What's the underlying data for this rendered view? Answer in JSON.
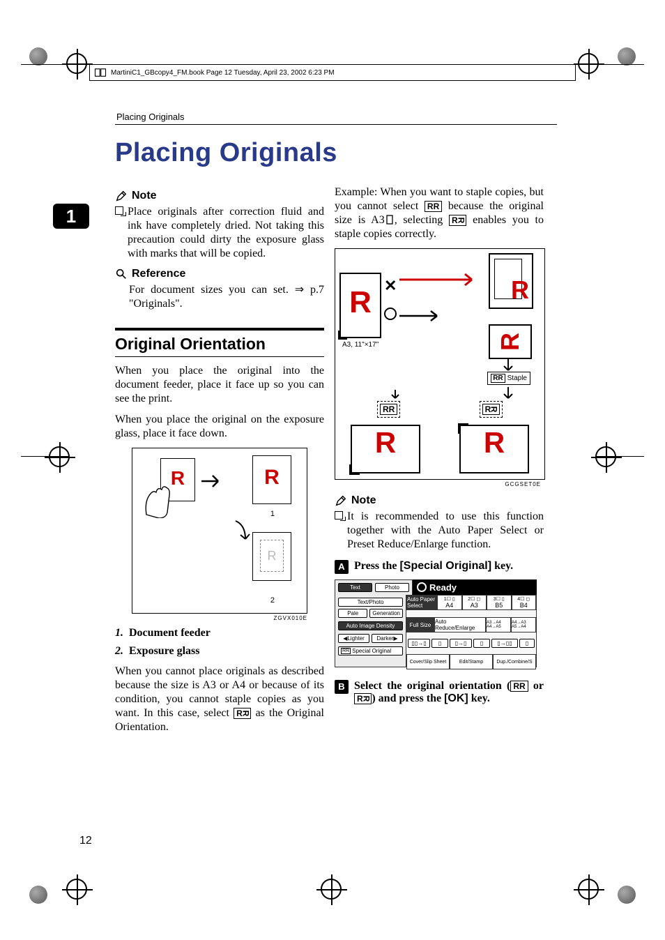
{
  "meta_line": "MartiniC1_GBcopy4_FM.book  Page 12  Tuesday, April 23, 2002  6:23 PM",
  "running_head": "Placing Originals",
  "headline": "Placing Originals",
  "chapter_tab": "1",
  "page_number": "12",
  "left": {
    "note_label": "Note",
    "note_body": "Place originals after correction fluid and ink have completely dried. Not taking this precaution could dirty the exposure glass with marks that will be copied.",
    "ref_label": "Reference",
    "ref_body_1": "For document sizes you can set. ⇒ p.7 \"Originals\".",
    "subhead": "Original Orientation",
    "para1": "When you place the original into the document feeder, place it face up so you can see the print.",
    "para2": "When you place the original on the exposure glass, place it face down.",
    "fig_code": "ZGVX010E",
    "fig_num1": "1",
    "fig_num2": "2",
    "item1_num": "1.",
    "item1_label": "Document feeder",
    "item2_num": "2.",
    "item2_label": "Exposure glass",
    "para3_a": "When you cannot place originals as described because the size is A3 or A4 or because of its condition, you cannot staple copies as you want. In this case, select ",
    "para3_b": " as the Original Orientation."
  },
  "right": {
    "example_a": "Example: When you want to staple copies, but you cannot select ",
    "example_b": " because the original size is A3",
    "example_c": ", selecting ",
    "example_d": " enables you to staple copies correctly.",
    "fig2_label": "A3, 11\"×17\"",
    "fig2_staple": "Staple",
    "fig2_code": "GCGSET0E",
    "note_label": "Note",
    "note_body": "It is recommended to use this function together with the Auto Paper Select or Preset Reduce/Enlarge function.",
    "step1_num": "A",
    "step1_a": "Press the ",
    "step1_key": "[Special Original]",
    "step1_b": " key.",
    "step2_num": "B",
    "step2_a": "Select the original orientation (",
    "step2_b": " or ",
    "step2_c": ") and press the ",
    "step2_key": "[OK]",
    "step2_d": " key.",
    "panel": {
      "ready": "Ready",
      "tabs": {
        "text": "Text",
        "photo": "Photo",
        "textphoto": "Text/Photo",
        "pale": "Pale",
        "generation": "Generation"
      },
      "auto_image_density": "Auto Image Density",
      "lighter": "Lighter",
      "darker": "Darker",
      "special_original": "Special Original",
      "auto_paper_select": "Auto Paper Select",
      "full_size": "Full Size",
      "auto_reduce_enlarge": "Auto Reduce/Enlarge",
      "ratio1": "A3→A4 A4→A5",
      "ratio2": "A4→A3 A5→A4",
      "trays": {
        "t1": "A4",
        "t2": "A3",
        "t3": "B5",
        "t4": "B4"
      },
      "tray_nums": [
        "1",
        "2",
        "3",
        "4"
      ],
      "cover_slip": "Cover/Slip Sheet",
      "edit_stamp": "Edit/Stamp",
      "dup_combine": "Dup./Combine/S"
    }
  }
}
